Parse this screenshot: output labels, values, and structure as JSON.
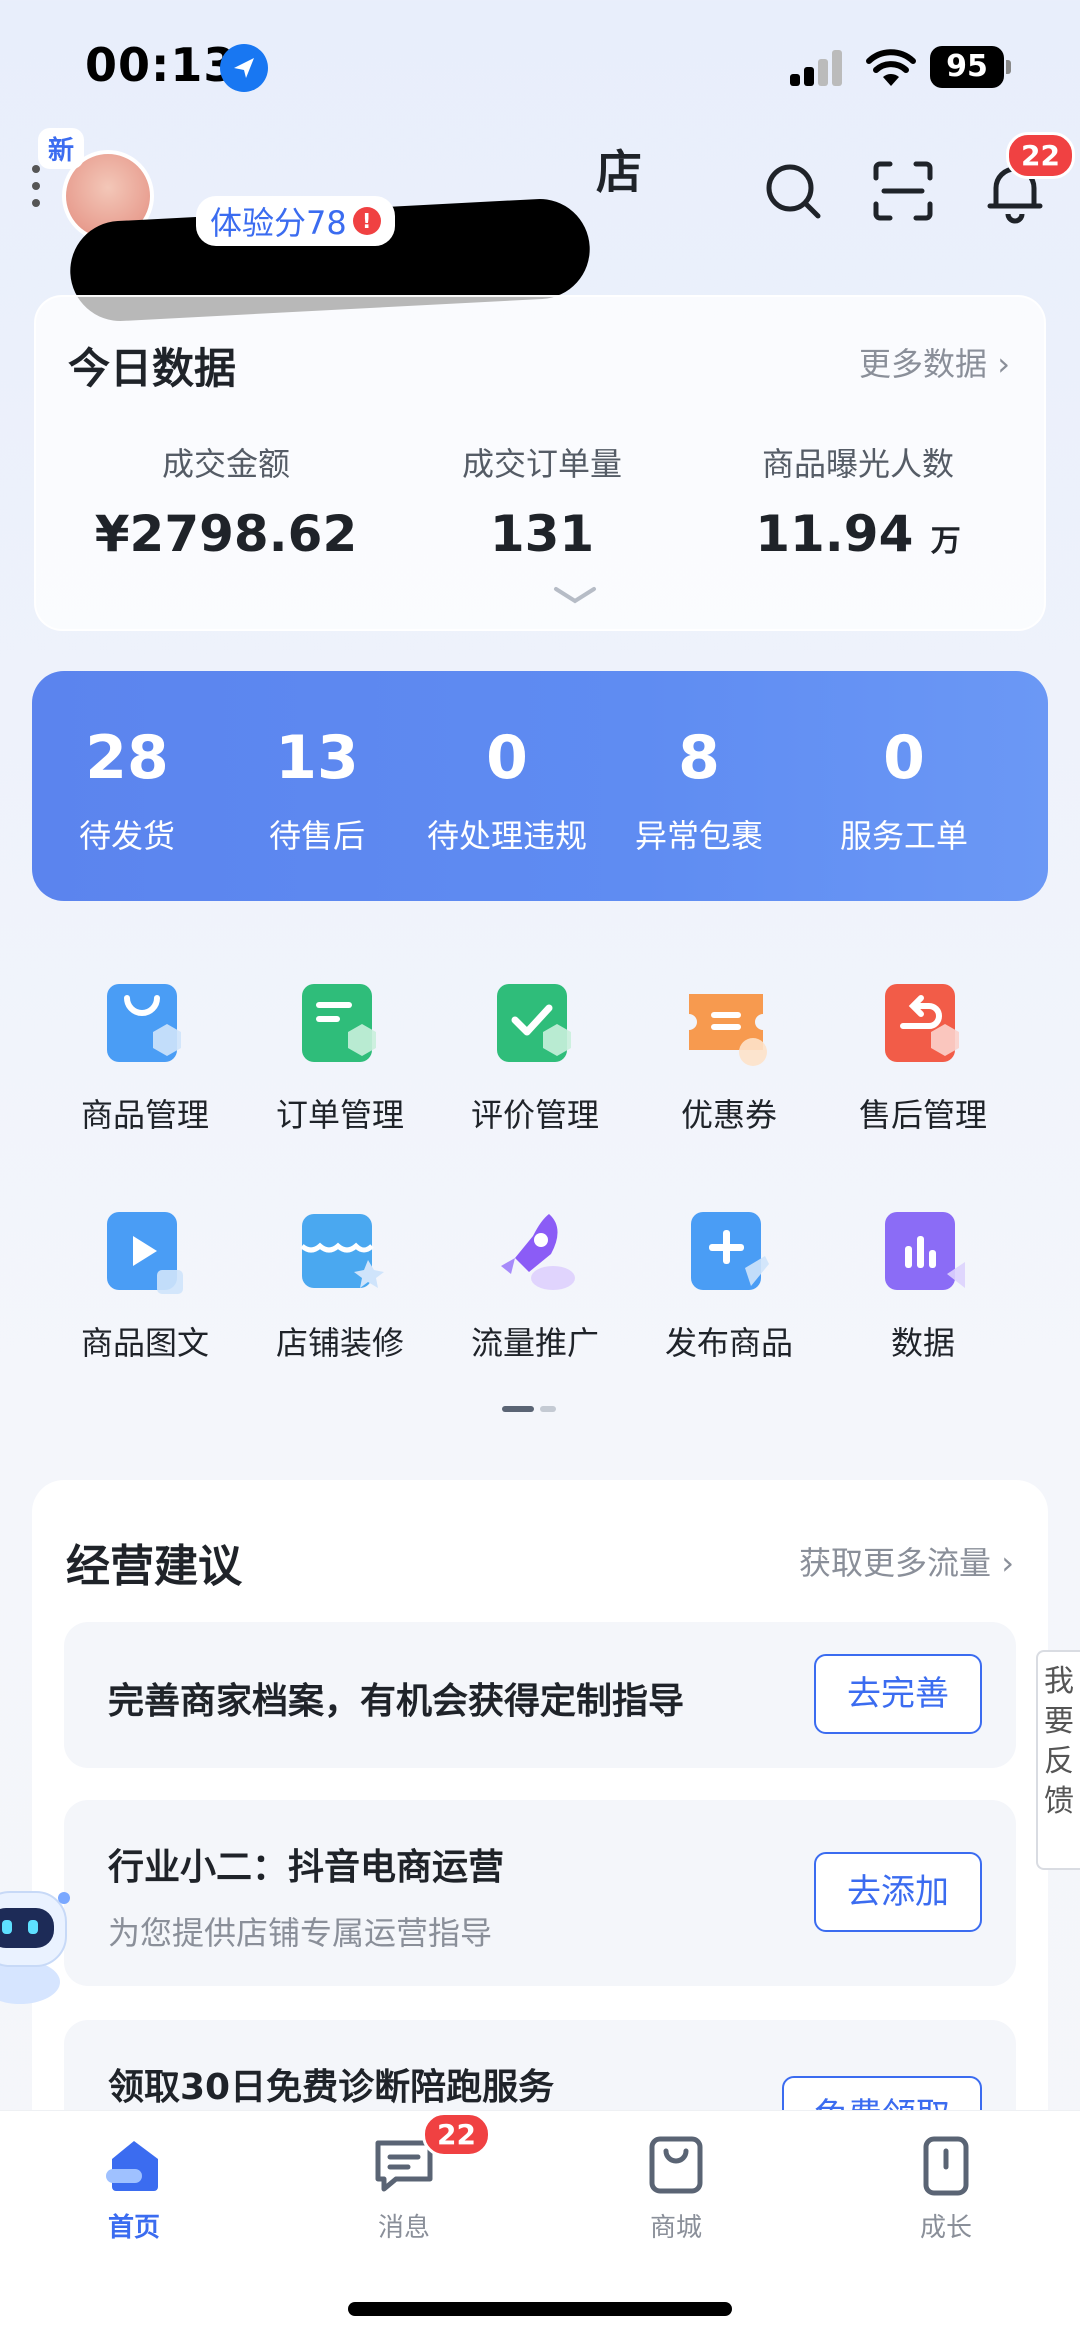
{
  "status_bar": {
    "time": "00:13",
    "battery": "95"
  },
  "header": {
    "new_badge": "新",
    "shop_name_suffix": "店",
    "experience_score": "体验分78",
    "experience_warn": "!",
    "notification_count": "22"
  },
  "today_data": {
    "title": "今日数据",
    "more_link": "更多数据 ›",
    "stats": [
      {
        "label": "成交金额",
        "value": "¥2798.62",
        "unit": ""
      },
      {
        "label": "成交订单量",
        "value": "131",
        "unit": ""
      },
      {
        "label": "商品曝光人数",
        "value": "11.94",
        "unit": "万"
      }
    ]
  },
  "todo": [
    {
      "count": "28",
      "label": "待发货"
    },
    {
      "count": "13",
      "label": "待售后"
    },
    {
      "count": "0",
      "label": "待处理违规"
    },
    {
      "count": "8",
      "label": "异常包裹"
    },
    {
      "count": "0",
      "label": "服务工单"
    }
  ],
  "tools": [
    {
      "label": "商品管理"
    },
    {
      "label": "订单管理"
    },
    {
      "label": "评价管理"
    },
    {
      "label": "优惠券"
    },
    {
      "label": "售后管理"
    },
    {
      "label": "商品图文"
    },
    {
      "label": "店铺装修"
    },
    {
      "label": "流量推广"
    },
    {
      "label": "发布商品"
    },
    {
      "label": "数据"
    }
  ],
  "suggestions": {
    "title": "经营建议",
    "more_link": "获取更多流量 ›",
    "items": [
      {
        "title": "完善商家档案，有机会获得定制指导",
        "subtitle": "",
        "button": "去完善"
      },
      {
        "title": "行业小二：抖音电商运营",
        "subtitle": "为您提供店铺专属运营指导",
        "button": "去添加"
      },
      {
        "title": "领取30日免费诊断陪跑服务",
        "subtitle": "",
        "button": "免费领取"
      }
    ]
  },
  "feedback": "我要反馈",
  "tabbar": {
    "tabs": [
      {
        "label": "首页"
      },
      {
        "label": "消息"
      },
      {
        "label": "商城"
      },
      {
        "label": "成长"
      }
    ],
    "message_badge": "22"
  }
}
